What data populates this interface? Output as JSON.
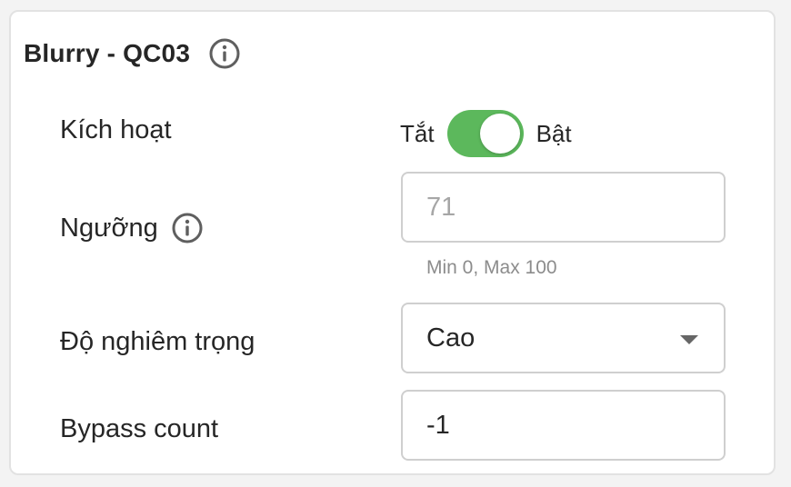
{
  "card": {
    "title": "Blurry - QC03",
    "info_icon": "info-circle-icon"
  },
  "fields": {
    "activate": {
      "label": "Kích hoạt",
      "off_label": "Tắt",
      "on_label": "Bật",
      "state": "on",
      "accent_color": "#5cb85c"
    },
    "threshold": {
      "label": "Ngưỡng",
      "info_icon": "info-circle-icon",
      "placeholder": "71",
      "hint": "Min 0, Max 100"
    },
    "severity": {
      "label": "Độ nghiêm trọng",
      "selected": "Cao",
      "dropdown_icon": "caret-down-icon"
    },
    "bypass": {
      "label": "Bypass count",
      "value": "-1"
    }
  }
}
